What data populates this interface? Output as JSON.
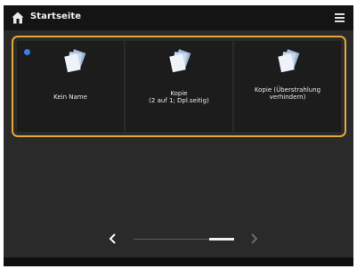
{
  "titlebar": {
    "title": "Startseite"
  },
  "tiles": [
    {
      "label": "Kein Name",
      "selected": true
    },
    {
      "label": "Kopie\n(2 auf 1; Dpl.seitig)",
      "selected": false
    },
    {
      "label": "Kopie (Überstrahlung\nverhindern)",
      "selected": false
    }
  ],
  "pager": {
    "prev_icon": "chevron-left-icon",
    "next_icon": "chevron-right-icon",
    "page": 2,
    "pages": 2
  },
  "colors": {
    "accent_border": "#e9a83a",
    "selected_dot": "#3b7de0",
    "background": "#2a2a2a",
    "tile": "#1c1c1c",
    "titlebar": "#141414"
  }
}
